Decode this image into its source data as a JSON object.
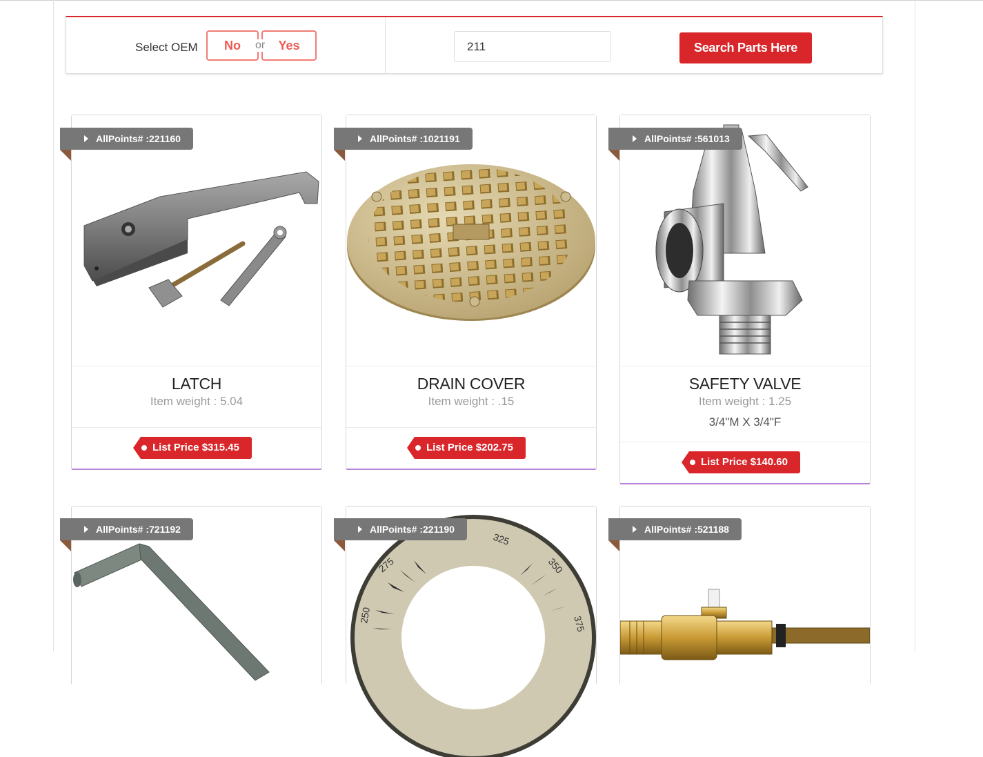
{
  "search": {
    "oem_label": "Select OEM",
    "no_label": "No",
    "or_label": "or",
    "yes_label": "Yes",
    "query": "211",
    "button_label": "Search Parts Here"
  },
  "colors": {
    "accent": "#d9262b",
    "ribbon": "#777777",
    "toggle_border": "#f07b74",
    "card_underline": "#b783d8"
  },
  "products": [
    {
      "id": "AllPoints# :221160",
      "title": "LATCH",
      "weight": "Item weight : 5.04",
      "description": "",
      "price": "List Price $315.45",
      "image": "latch-image"
    },
    {
      "id": "AllPoints# :1021191",
      "title": "DRAIN COVER",
      "weight": "Item weight : .15",
      "description": "",
      "price": "List Price $202.75",
      "image": "drain-cover-image"
    },
    {
      "id": "AllPoints# :561013",
      "title": "SAFETY VALVE",
      "weight": "Item weight : 1.25",
      "description": "3/4\"M X 3/4\"F",
      "price": "List Price $140.60",
      "image": "safety-valve-image"
    },
    {
      "id": "AllPoints# :721192",
      "image": "hex-key-image"
    },
    {
      "id": "AllPoints# :221190",
      "image": "thermostat-dial-image",
      "dial_labels": [
        "250",
        "275",
        "325",
        "350",
        "375"
      ]
    },
    {
      "id": "AllPoints# :521188",
      "image": "brass-valve-image"
    }
  ]
}
